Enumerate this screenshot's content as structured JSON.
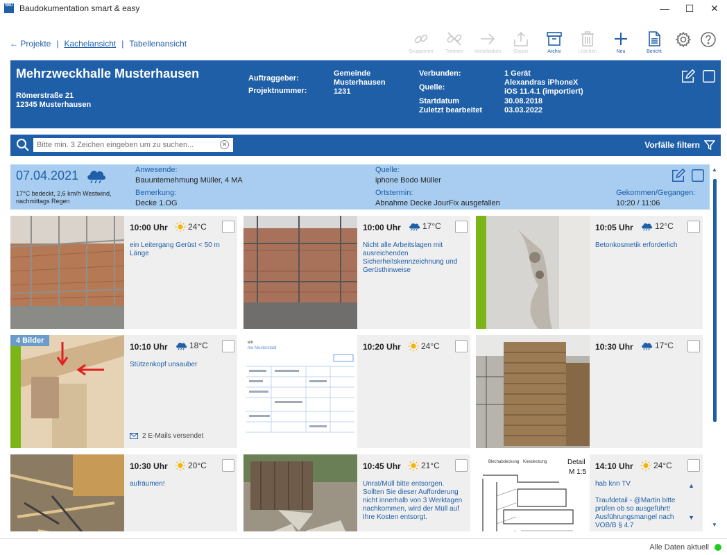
{
  "window": {
    "title": "Baudokumentation smart & easy",
    "logo_text": "BAU",
    "min": "—",
    "max": "☐",
    "close": "✕"
  },
  "nav": {
    "back": "← Projekte",
    "sep1": "|",
    "tiles": "Kachelansicht",
    "sep2": "|",
    "table": "Tabellenansicht"
  },
  "toolbar": {
    "group": "Gruppieren",
    "split": "Trennen",
    "move": "Verschieben",
    "export": "Export",
    "archive": "Archiv",
    "delete": "Löschen",
    "new": "Neu",
    "report": "Bericht"
  },
  "project": {
    "title": "Mehrzweckhalle Musterhausen",
    "street": "Römerstraße 21",
    "city": "12345 Musterhausen",
    "client_label": "Auftraggeber:",
    "client_value_1": "Gemeinde",
    "client_value_2": "Musterhausen",
    "number_label": "Projektnummer:",
    "number_value": "1231",
    "connected_label": "Verbunden:",
    "connected_value": "1 Gerät",
    "source_label": "Quelle:",
    "source_value_1": "Alexandras iPhoneX",
    "source_value_2": "iOS 11.4.1 (importiert)",
    "start_label": "Startdatum",
    "start_value": "30.08.2018",
    "edited_label": "Zuletzt bearbeitet",
    "edited_value": "03.03.2022"
  },
  "search": {
    "placeholder": "Bitte min. 3 Zeichen eingeben um zu suchen...",
    "clear": "✕",
    "filter_label": "Vorfälle filtern"
  },
  "day": {
    "date": "07.04.2021",
    "weather_1": "17°C bedeckt, 2,6 km/h Westwind,",
    "weather_2": "nachmittags Regen",
    "present_label": "Anwesende:",
    "present_value": "Bauunternehmung Müller, 4 MA",
    "remark_label": "Bemerkung:",
    "remark_value": "Decke 1.OG",
    "source_label": "Quelle:",
    "source_value": "iphone Bodo Müller",
    "appointment_label": "Ortstermin:",
    "appointment_value": "Abnahme Decke JourFix ausgefallen",
    "came_label": "Gekommen/Gegangen:",
    "came_value": "10:20 / 11:06"
  },
  "cards": [
    {
      "time": "10:00 Uhr",
      "weather": "sun",
      "temp": "24°C",
      "text": "ein Leitergang Gerüst < 50 m Länge",
      "photo": "scaffold-wall",
      "accent": false,
      "badge": "",
      "mail": ""
    },
    {
      "time": "10:00 Uhr",
      "weather": "cloud",
      "temp": "17°C",
      "text": "Nicht alle Arbeitslagen mit ausreichenden Sicherheitskennzeichnung und Gerüsthinweise",
      "photo": "scaffold-brick",
      "accent": false,
      "badge": "",
      "mail": ""
    },
    {
      "time": "10:05 Uhr",
      "weather": "cloud",
      "temp": "12°C",
      "text": "Betonkosmetik erforderlich",
      "photo": "concrete",
      "accent": true,
      "badge": "",
      "mail": ""
    },
    {
      "time": "10:10 Uhr",
      "weather": "cloud",
      "temp": "18°C",
      "text": "Stützenkopf unsauber",
      "photo": "timber-arrows",
      "accent": true,
      "badge": "4 Bilder",
      "mail": "2 E-Mails versendet"
    },
    {
      "time": "10:20 Uhr",
      "weather": "sun",
      "temp": "24°C",
      "text": "",
      "photo": "document",
      "accent": false,
      "badge": "",
      "mail": "",
      "doc_text_1": "ein",
      "doc_text_2": "rke Musterstadt"
    },
    {
      "time": "10:30 Uhr",
      "weather": "cloud",
      "temp": "17°C",
      "text": "",
      "photo": "lumber-stack",
      "accent": false,
      "badge": "",
      "mail": ""
    },
    {
      "time": "10:30 Uhr",
      "weather": "sun",
      "temp": "20°C",
      "text": "aufräumen!",
      "photo": "wood-clutter",
      "accent": false,
      "badge": "",
      "mail": ""
    },
    {
      "time": "10:45 Uhr",
      "weather": "sun",
      "temp": "21°C",
      "text": "Unrat/Müll bitte entsorgen. Sollten Sie dieser Aufforderung nicht innerhalb von 3 Werktagen nachkommen, wird der Müll auf Ihre Kosten entsorgt.",
      "photo": "debris",
      "accent": false,
      "badge": "",
      "mail": ""
    },
    {
      "time": "14:10 Uhr",
      "weather": "sun",
      "temp": "24°C",
      "text": "hab knn TV\n\nTraufdetail - @Martin bitte prüfen ob so ausgeführt! Ausführungsmangel nach VOB/B § 4.7",
      "photo": "drawing",
      "accent": false,
      "badge": "",
      "mail": "",
      "nav": true,
      "drawing_label_1": "Blechabdeckung",
      "drawing_label_2": "Kiesdeckung",
      "drawing_label_3": "Detail",
      "drawing_label_4": "M 1:5"
    }
  ],
  "status": {
    "text": "Alle Daten aktuell"
  },
  "colors": {
    "primary": "#1f5fa8",
    "day_bg": "#a8cdf0",
    "accent_green": "#7cb518",
    "status_green": "#22cc22"
  }
}
